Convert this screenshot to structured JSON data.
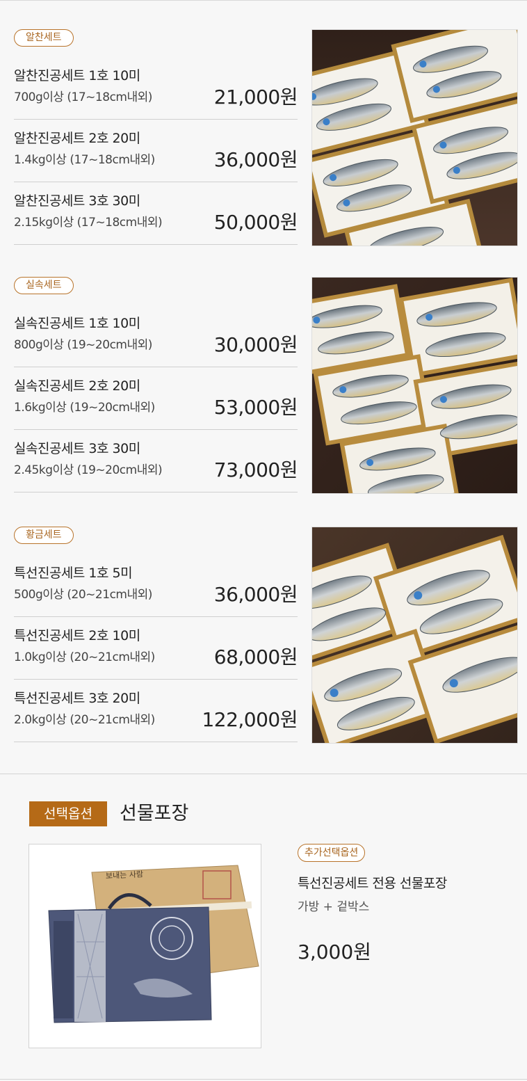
{
  "sets": [
    {
      "badge": "알찬세트",
      "items": [
        {
          "name": "알찬진공세트 1호 10미",
          "spec": "700g이상 (17~18cm내외)",
          "price": "21,000원"
        },
        {
          "name": "알찬진공세트 2호 20미",
          "spec": "1.4kg이상 (17~18cm내외)",
          "price": "36,000원"
        },
        {
          "name": "알찬진공세트 3호 30미",
          "spec": "2.15kg이상 (17~18cm내외)",
          "price": "50,000원"
        }
      ]
    },
    {
      "badge": "실속세트",
      "items": [
        {
          "name": "실속진공세트 1호 10미",
          "spec": "800g이상 (19~20cm내외)",
          "price": "30,000원"
        },
        {
          "name": "실속진공세트 2호 20미",
          "spec": "1.6kg이상 (19~20cm내외)",
          "price": "53,000원"
        },
        {
          "name": "실속진공세트 3호 30미",
          "spec": "2.45kg이상 (19~20cm내외)",
          "price": "73,000원"
        }
      ]
    },
    {
      "badge": "황금세트",
      "items": [
        {
          "name": "특선진공세트 1호 5미",
          "spec": "500g이상 (20~21cm내외)",
          "price": "36,000원"
        },
        {
          "name": "특선진공세트 2호 10미",
          "spec": "1.0kg이상 (20~21cm내외)",
          "price": "68,000원"
        },
        {
          "name": "특선진공세트 3호 20미",
          "spec": "2.0kg이상 (20~21cm내외)",
          "price": "122,000원"
        }
      ]
    }
  ],
  "option": {
    "tag": "선택옵션",
    "title": "선물포장",
    "extra_badge": "추가선택옵션",
    "extra_name": "특선진공세트 전용 선물포장",
    "extra_detail": "가방 + 겉박스",
    "extra_price": "3,000원",
    "box_label": "보내는 사람"
  },
  "colors": {
    "accent": "#b56a17",
    "badge_border": "#b8732a",
    "wood": "#3e2b22",
    "bag": "#4d5779",
    "box": "#d3b17c"
  }
}
